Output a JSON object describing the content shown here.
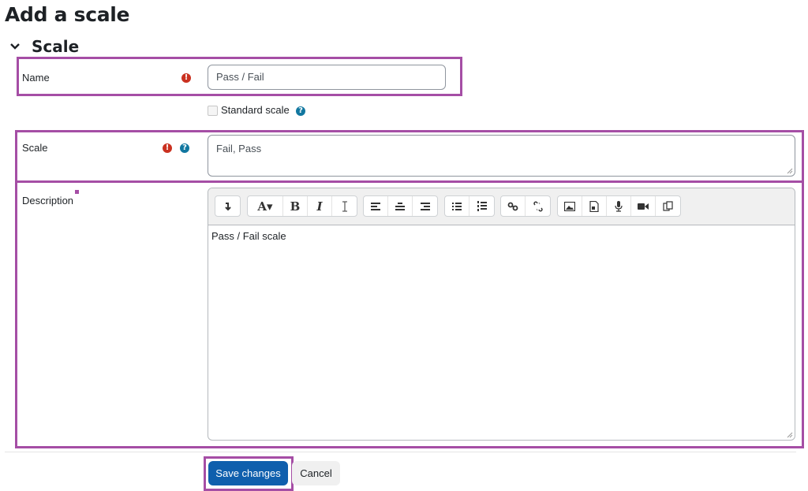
{
  "page": {
    "title": "Add a scale"
  },
  "section": {
    "title": "Scale",
    "expanded": true
  },
  "form": {
    "name": {
      "label": "Name",
      "required": true,
      "value": "Pass / Fail"
    },
    "standard_scale": {
      "label": "Standard scale",
      "checked": false,
      "has_help": true
    },
    "scale": {
      "label": "Scale",
      "required": true,
      "has_help": true,
      "value": "Fail, Pass"
    },
    "description": {
      "label": "Description",
      "value": "Pass / Fail scale",
      "toolbar": [
        [
          "collapse"
        ],
        [
          "text-style",
          "bold",
          "italic",
          "clear-formatting"
        ],
        [
          "align-left",
          "align-center",
          "align-right"
        ],
        [
          "unordered-list",
          "ordered-list"
        ],
        [
          "link",
          "unlink"
        ],
        [
          "image",
          "media",
          "record-audio",
          "record-video",
          "manage-files"
        ]
      ]
    }
  },
  "actions": {
    "save_label": "Save changes",
    "cancel_label": "Cancel"
  },
  "glyphs": {
    "error": "!",
    "help": "?",
    "text_style": "A▾",
    "bold": "B",
    "italic": "I",
    "collapse": "↧"
  },
  "colors": {
    "highlight": "#a54ea5",
    "primary": "#0f5fad",
    "error": "#ca3120",
    "help": "#1177a0"
  }
}
